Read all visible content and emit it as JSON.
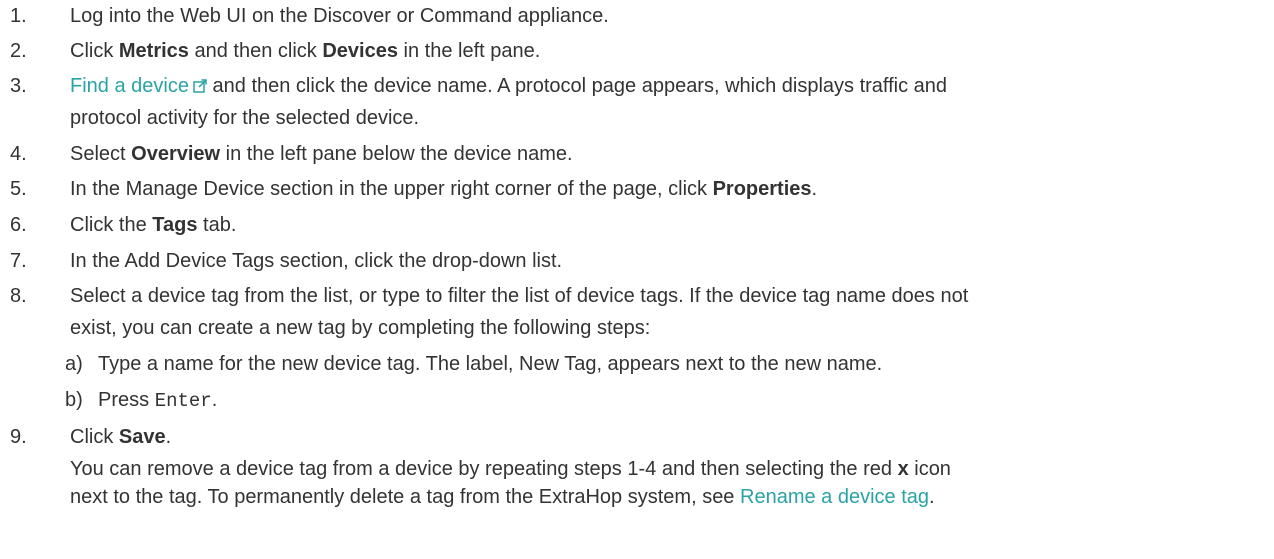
{
  "steps": [
    {
      "num": "1.",
      "text": "Log into the Web UI on the Discover or Command appliance."
    },
    {
      "num": "2.",
      "pre": "Click ",
      "bold1": "Metrics",
      "mid": " and then click ",
      "bold2": "Devices",
      "post": " in the left pane."
    },
    {
      "num": "3.",
      "link": "Find a device",
      "line1": " and then click the device name. A protocol page appears, which displays traffic and",
      "line2": "protocol activity for the selected device."
    },
    {
      "num": "4.",
      "pre": "Select ",
      "bold": "Overview",
      "post": " in the left pane below the device name."
    },
    {
      "num": "5.",
      "pre": "In the Manage Device section in the upper right corner of the page, click ",
      "bold": "Properties",
      "post": "."
    },
    {
      "num": "6.",
      "pre": "Click the ",
      "bold": "Tags",
      "post": " tab."
    },
    {
      "num": "7.",
      "text": "In the Add Device Tags section, click the drop-down list."
    },
    {
      "num": "8.",
      "line1": "Select a device tag from the list, or type to filter the list of device tags. If the device tag name does not",
      "line2": "exist, you can create a new tag by completing the following steps:"
    },
    {
      "num": "9.",
      "pre": "Click ",
      "bold": "Save",
      "post": ".",
      "note1_pre": "You can remove a device tag from a device by repeating steps 1-4 and then selecting the red ",
      "note1_bold": "x",
      "note1_post": " icon",
      "note2_pre": "next to the tag. To permanently delete a tag from the ExtraHop system, see ",
      "note2_link": "Rename a device tag",
      "note2_post": "."
    }
  ],
  "substeps": [
    {
      "letter": "a)",
      "text": "Type a name for the new device tag. The label, New Tag, appears next to the new name."
    },
    {
      "letter": "b)",
      "pre": "Press ",
      "code": "Enter",
      "post": "."
    }
  ],
  "colors": {
    "link": "#2aa3a6",
    "text": "#333333"
  },
  "icons": {
    "external_link": "external-link-icon"
  }
}
